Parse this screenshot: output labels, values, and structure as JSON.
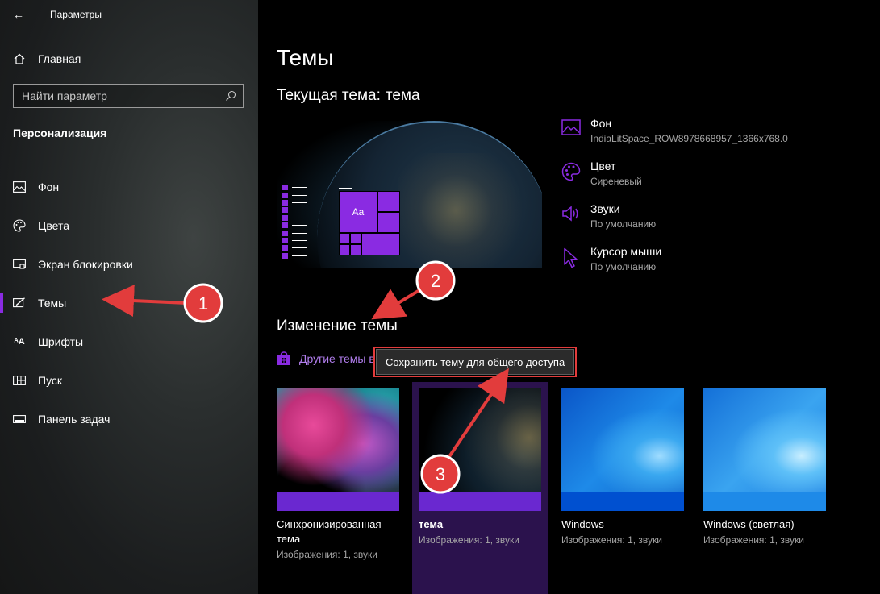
{
  "window": {
    "title": "Параметры",
    "back_icon": "←"
  },
  "sidebar": {
    "home_label": "Главная",
    "search_placeholder": "Найти параметр",
    "section_heading": "Персонализация",
    "items": [
      {
        "label": "Фон",
        "icon": "picture-icon"
      },
      {
        "label": "Цвета",
        "icon": "palette-icon"
      },
      {
        "label": "Экран блокировки",
        "icon": "lock-screen-icon"
      },
      {
        "label": "Темы",
        "icon": "themes-icon",
        "active": true
      },
      {
        "label": "Шрифты",
        "icon": "font-icon"
      },
      {
        "label": "Пуск",
        "icon": "start-icon"
      },
      {
        "label": "Панель задач",
        "icon": "taskbar-icon"
      }
    ]
  },
  "main": {
    "page_title": "Темы",
    "current_theme_prefix": "Текущая тема:",
    "current_theme_name": "тема",
    "preview": {
      "tile_text": "Aa"
    },
    "info": [
      {
        "title": "Фон",
        "value": "IndiaLitSpace_ROW8978668957_1366x768.0",
        "icon": "picture-icon"
      },
      {
        "title": "Цвет",
        "value": "Сиреневый",
        "icon": "palette-icon"
      },
      {
        "title": "Звуки",
        "value": "По умолчанию",
        "icon": "speaker-icon"
      },
      {
        "title": "Курсор мыши",
        "value": "По умолчанию",
        "icon": "cursor-icon"
      }
    ],
    "change_heading": "Изменение темы",
    "store_link": "Другие темы в",
    "tooltip": "Сохранить тему для общего доступа",
    "themes": [
      {
        "name": "Синхронизированная тема",
        "desc": "Изображения: 1, звуки"
      },
      {
        "name": "тема",
        "desc": "Изображения: 1, звуки",
        "selected": true
      },
      {
        "name": "Windows",
        "desc": "Изображения: 1, звуки"
      },
      {
        "name": "Windows (светлая)",
        "desc": "Изображения: 1, звуки"
      }
    ]
  },
  "annotations": {
    "badge_1": "1",
    "badge_2": "2",
    "badge_3": "3"
  },
  "colors": {
    "accent": "#8a2be2",
    "link": "#b07dec",
    "annotation": "#e23c3c"
  }
}
